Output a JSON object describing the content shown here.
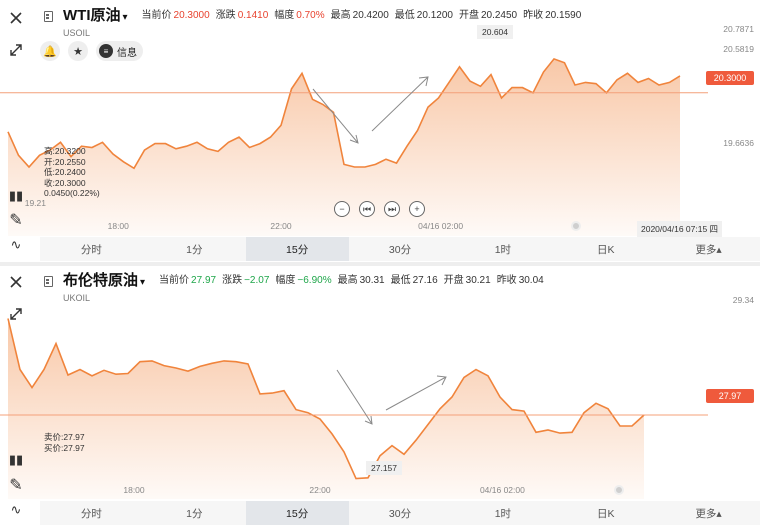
{
  "wti": {
    "title": "WTI原油",
    "code": "USOIL",
    "stats": [
      {
        "label": "当前价",
        "value": "20.3000",
        "tone": "red"
      },
      {
        "label": "涨跌",
        "value": "0.1410",
        "tone": "red"
      },
      {
        "label": "幅度",
        "value": "0.70%",
        "tone": "red"
      },
      {
        "label": "最高",
        "value": "20.4200",
        "tone": ""
      },
      {
        "label": "最低",
        "value": "20.1200",
        "tone": ""
      },
      {
        "label": "开盘",
        "value": "20.2450",
        "tone": ""
      },
      {
        "label": "昨收",
        "value": "20.1590",
        "tone": ""
      }
    ],
    "info_label": "信息",
    "ohlc": [
      "高:20.3200",
      "开:20.2550",
      "低:20.2400",
      "收:20.3000",
      "0.0450(0.22%)"
    ],
    "current_price_tag": "20.3000",
    "callout": "20.604",
    "date_label": "2020/04/16 07:15 四",
    "chart_data": {
      "type": "area",
      "title": "",
      "xlabel": "",
      "ylabel": "",
      "y_tick_labels": [
        "20.7871",
        "20.5819",
        "19.6636",
        "19.21"
      ],
      "ylim": [
        19.2,
        20.79
      ],
      "current_value": 20.3,
      "x_tick_labels": [
        "18:00",
        "22:00",
        "04/16 02:00"
      ],
      "x_ticks_at": [
        10.5,
        26,
        41.2
      ],
      "values": [
        20.0,
        19.82,
        19.73,
        19.82,
        19.86,
        19.92,
        19.81,
        19.89,
        19.88,
        19.92,
        19.83,
        19.77,
        19.72,
        19.86,
        19.91,
        19.91,
        19.87,
        19.89,
        19.92,
        19.87,
        19.85,
        19.92,
        19.96,
        19.88,
        19.91,
        19.96,
        20.05,
        20.33,
        20.45,
        20.25,
        20.21,
        20.15,
        19.75,
        19.73,
        19.73,
        19.75,
        19.79,
        19.76,
        19.89,
        20.01,
        20.19,
        20.26,
        20.38,
        20.5,
        20.39,
        20.35,
        20.44,
        20.26,
        20.34,
        20.34,
        20.3,
        20.46,
        20.56,
        20.53,
        20.36,
        20.38,
        20.37,
        20.3,
        20.4,
        20.45,
        20.38,
        20.41,
        20.36,
        20.38,
        20.43
      ]
    }
  },
  "brent": {
    "title": "布伦特原油",
    "code": "UKOIL",
    "stats": [
      {
        "label": "当前价",
        "value": "27.97",
        "tone": "green"
      },
      {
        "label": "涨跌",
        "value": "−2.07",
        "tone": "green"
      },
      {
        "label": "幅度",
        "value": "−6.90%",
        "tone": "green"
      },
      {
        "label": "最高",
        "value": "30.31",
        "tone": ""
      },
      {
        "label": "最低",
        "value": "27.16",
        "tone": ""
      },
      {
        "label": "开盘",
        "value": "30.21",
        "tone": ""
      },
      {
        "label": "昨收",
        "value": "30.04",
        "tone": ""
      }
    ],
    "quote": [
      "卖价:27.97",
      "买价:27.97"
    ],
    "current_price_tag": "27.97",
    "callout": "27.157",
    "chart_data": {
      "type": "area",
      "title": "",
      "xlabel": "",
      "ylabel": "",
      "y_tick_labels": [
        "29.34"
      ],
      "ylim": [
        26.9,
        29.5
      ],
      "current_value": 27.97,
      "x_tick_labels": [
        "18:00",
        "22:00",
        "04/16 02:00"
      ],
      "x_ticks_at": [
        10.5,
        26,
        41.2
      ],
      "values": [
        29.2,
        28.55,
        28.32,
        28.55,
        28.88,
        28.48,
        28.55,
        28.47,
        28.54,
        28.49,
        28.5,
        28.65,
        28.66,
        28.6,
        28.57,
        28.53,
        28.59,
        28.63,
        28.66,
        28.65,
        28.62,
        28.24,
        28.25,
        28.28,
        28.04,
        28.0,
        27.92,
        27.73,
        27.5,
        27.16,
        27.17,
        27.45,
        27.58,
        27.47,
        27.65,
        27.85,
        28.05,
        28.2,
        28.45,
        28.55,
        28.47,
        28.2,
        28.04,
        28.02,
        27.75,
        27.78,
        27.74,
        27.75,
        28.0,
        28.12,
        28.05,
        27.83,
        27.83,
        27.97
      ]
    }
  },
  "tabs": [
    "分时",
    "1分",
    "15分",
    "30分",
    "1时",
    "日K",
    "更多▴"
  ],
  "active_tab": "15分",
  "icons": {
    "close": "close-icon",
    "expand": "expand-icon",
    "bell": "bell-icon",
    "star": "star-icon",
    "candle": "candlestick-icon",
    "pen": "pen-icon",
    "indicator": "indicator-icon"
  },
  "colors": {
    "line": "#f0843c",
    "up": "#e8432f",
    "down": "#1fa64a",
    "tag": "#ef5a3c"
  }
}
